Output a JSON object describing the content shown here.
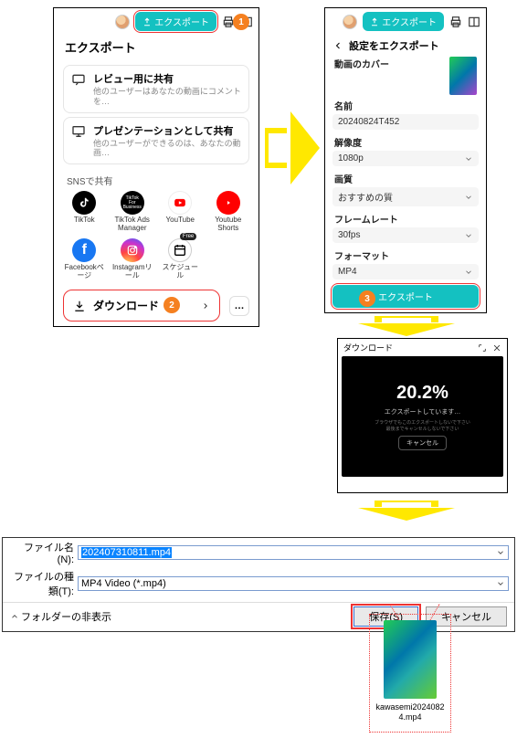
{
  "panelA": {
    "exportBtn": "エクスポート",
    "title": "エクスポート",
    "card1": {
      "title": "レビュー用に共有",
      "sub": "他のユーザーはあなたの動画にコメントを…"
    },
    "card2": {
      "title": "プレゼンテーションとして共有",
      "sub": "他のユーザーができるのは、あなたの動画…"
    },
    "snsLabel": "SNSで共有",
    "sns": [
      {
        "name": "TikTok"
      },
      {
        "name": "TikTok Ads Manager"
      },
      {
        "name": "YouTube"
      },
      {
        "name": "Youtube Shorts"
      },
      {
        "name": "Facebookページ"
      },
      {
        "name": "Instagramリール"
      },
      {
        "name": "スケジュール",
        "free": "Free"
      }
    ],
    "download": "ダウンロード",
    "more": "…"
  },
  "panelB": {
    "exportBtnTop": "エクスポート",
    "back": "設定をエクスポート",
    "coverLabel": "動画のカバー",
    "nameLabel": "名前",
    "nameValue": "20240824T452",
    "resLabel": "解像度",
    "resValue": "1080p",
    "qualityLabel": "画質",
    "qualityValue": "おすすめの質",
    "fpsLabel": "フレームレート",
    "fpsValue": "30fps",
    "fmtLabel": "フォーマット",
    "fmtValue": "MP4",
    "exportBtn": "エクスポート"
  },
  "panelC": {
    "title": "ダウンロード",
    "percent": "20.2%",
    "msg": "エクスポートしています…",
    "tiny1": "ブラウザでもこのエクスポートしないで下さい",
    "tiny2": "最後までキャンセルしないで下さい",
    "cancel": "キャンセル"
  },
  "panelD": {
    "fileNameLabel": "ファイル名(N):",
    "fileNameValue": "202407310811.mp4",
    "fileTypeLabel": "ファイルの種類(T):",
    "fileTypeValue": "MP4 Video (*.mp4)",
    "hideFolders": "フォルダーの非表示",
    "save": "保存(S)",
    "cancel": "キャンセル"
  },
  "resultFile": "kawasemi20240824.mp4",
  "badges": {
    "b1": "1",
    "b2": "2",
    "b3": "3"
  }
}
